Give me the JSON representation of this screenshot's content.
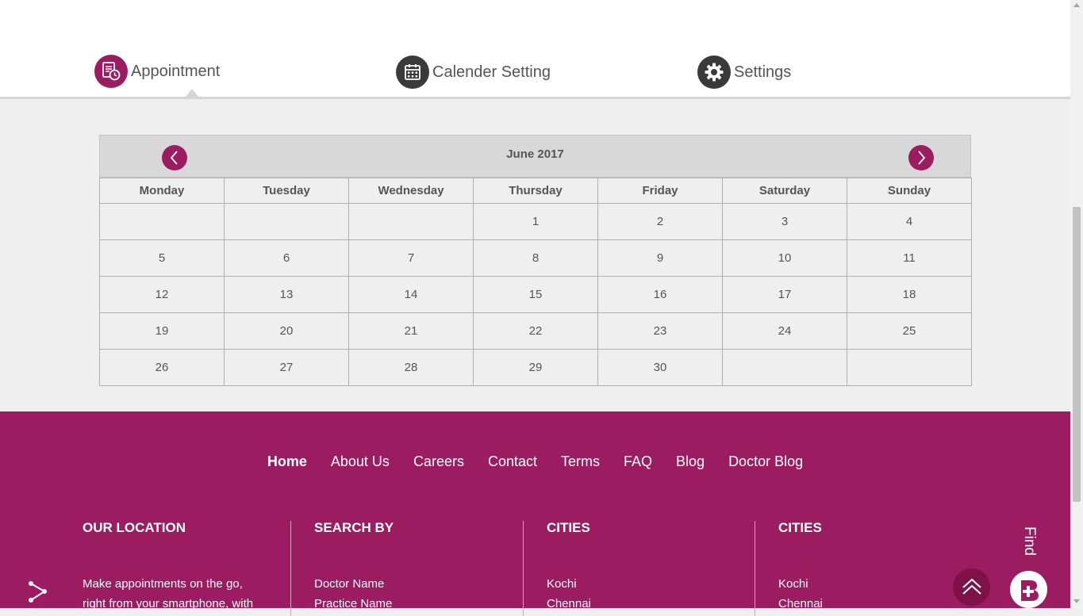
{
  "tabs": {
    "appointment": "Appointment",
    "calendar": "Calender Setting",
    "settings": "Settings"
  },
  "calendar": {
    "month_title": "June 2017",
    "days": [
      "Monday",
      "Tuesday",
      "Wednesday",
      "Thursday",
      "Friday",
      "Saturday",
      "Sunday"
    ],
    "weeks": [
      [
        "",
        "",
        "",
        "1",
        "2",
        "3",
        "4"
      ],
      [
        "5",
        "6",
        "7",
        "8",
        "9",
        "10",
        "11"
      ],
      [
        "12",
        "13",
        "14",
        "15",
        "16",
        "17",
        "18"
      ],
      [
        "19",
        "20",
        "21",
        "22",
        "23",
        "24",
        "25"
      ],
      [
        "26",
        "27",
        "28",
        "29",
        "30",
        "",
        ""
      ]
    ]
  },
  "footer": {
    "nav": [
      "Home",
      "About Us",
      "Careers",
      "Contact",
      "Terms",
      "FAQ",
      "Blog",
      "Doctor Blog"
    ],
    "col1_title": "OUR LOCATION",
    "col1_text_1": "Make appointments on the go,",
    "col1_text_2": "right from your smartphone, with",
    "col2_title": "SEARCH BY",
    "col2_items": [
      "Doctor Name",
      "Practice Name"
    ],
    "col3_title": "CITIES",
    "col3_items": [
      "Kochi",
      "Chennai"
    ],
    "col4_title": "CITIES",
    "col4_items": [
      "Kochi",
      "Chennai"
    ],
    "find_label": "Find"
  },
  "colors": {
    "brand": "#9c1c62",
    "dark_icon": "#3a3a3a",
    "background": "#efefef"
  },
  "icons": {
    "appointment": "appointment-clock-icon",
    "calendar": "calendar-icon",
    "settings": "gear-icon",
    "prev": "chevron-left-icon",
    "next": "chevron-right-icon",
    "share": "share-icon",
    "scroll_top": "double-chevron-up-icon"
  }
}
